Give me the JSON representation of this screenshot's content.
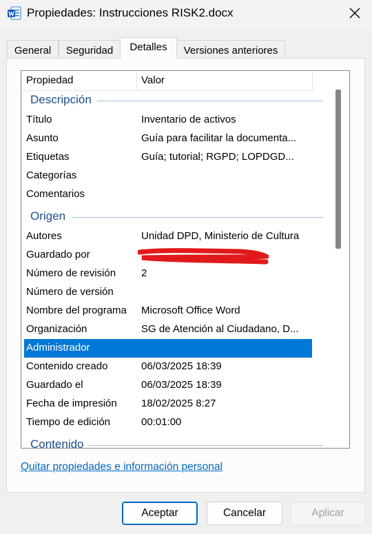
{
  "window": {
    "title": "Propiedades: Instrucciones RISK2.docx",
    "icon": "word-doc-icon"
  },
  "tabs": [
    {
      "label": "General",
      "active": false
    },
    {
      "label": "Seguridad",
      "active": false
    },
    {
      "label": "Detalles",
      "active": true
    },
    {
      "label": "Versiones anteriores",
      "active": false
    }
  ],
  "table": {
    "col_property": "Propiedad",
    "col_value": "Valor",
    "groups": {
      "descripcion": "Descripción",
      "origen": "Origen",
      "contenido": "Contenido"
    },
    "rows": [
      {
        "name": "Título",
        "value": "Inventario de activos"
      },
      {
        "name": "Asunto",
        "value": "Guía para facilitar la documenta..."
      },
      {
        "name": "Etiquetas",
        "value": "Guía; tutorial; RGPD; LOPDGD..."
      },
      {
        "name": "Categorías",
        "value": ""
      },
      {
        "name": "Comentarios",
        "value": ""
      },
      {
        "name": "Autores",
        "value": "Unidad DPD, Ministerio de Cultura"
      },
      {
        "name": "Guardado por",
        "value": ""
      },
      {
        "name": "Número de revisión",
        "value": "2"
      },
      {
        "name": "Número de versión",
        "value": ""
      },
      {
        "name": "Nombre del programa",
        "value": "Microsoft Office Word"
      },
      {
        "name": "Organización",
        "value": "SG de Atención al Ciudadano, D..."
      },
      {
        "name": "Administrador",
        "value": "",
        "selected": true
      },
      {
        "name": "Contenido creado",
        "value": "06/03/2025 18:39"
      },
      {
        "name": "Guardado el",
        "value": "06/03/2025 18:39"
      },
      {
        "name": "Fecha de impresión",
        "value": "18/02/2025 8:27"
      },
      {
        "name": "Tiempo de edición",
        "value": "00:01:00"
      }
    ]
  },
  "link_text": "Quitar propiedades e información personal",
  "buttons": {
    "ok": "Aceptar",
    "cancel": "Cancelar",
    "apply": "Aplicar"
  },
  "colors": {
    "selection": "#0078d7",
    "group_header": "#1f4e8c",
    "link": "#0067c0",
    "redaction": "#e01a1a"
  }
}
